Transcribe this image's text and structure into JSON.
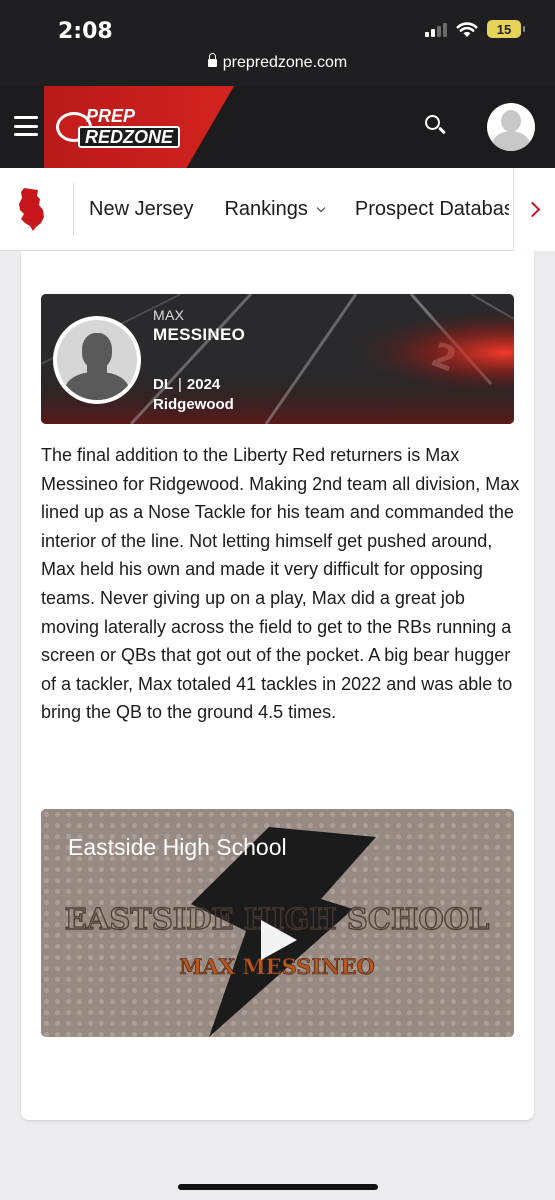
{
  "status_bar": {
    "time": "2:08",
    "battery": "15"
  },
  "browser": {
    "url": "prepredzone.com"
  },
  "header": {
    "logo_line1": "PREP",
    "logo_line2": "REDZONE",
    "brand_color": "#c8171c"
  },
  "nav": {
    "items": [
      {
        "label": "New Jersey",
        "has_dropdown": false
      },
      {
        "label": "Rankings",
        "has_dropdown": true
      },
      {
        "label": "Prospect Database",
        "has_dropdown": false
      }
    ]
  },
  "player": {
    "first_name": "MAX",
    "last_name": "MESSINEO",
    "position": "DL",
    "class_year": "2024",
    "school": "Ridgewood"
  },
  "article": {
    "body": "The final addition to the Liberty Red returners is Max Messineo for Ridgewood. Making 2nd team all division, Max lined up as a Nose Tackle for his team and commanded the interior of the line. Not letting himself get pushed around, Max held his own and made it very difficult for opposing teams. Never giving up on a play, Max did a great job moving laterally across the field to get to the RBs running a screen or QBs that got out of the pocket. A big bear hugger of a tackler, Max totaled 41 tackles in 2022 and was able to bring the QB to the ground 4.5 times."
  },
  "video": {
    "title": "Eastside High School",
    "thumbnail_heading": "EASTSIDE HIGH SCHOOL",
    "thumbnail_subheading": "MAX MESSINEO"
  }
}
